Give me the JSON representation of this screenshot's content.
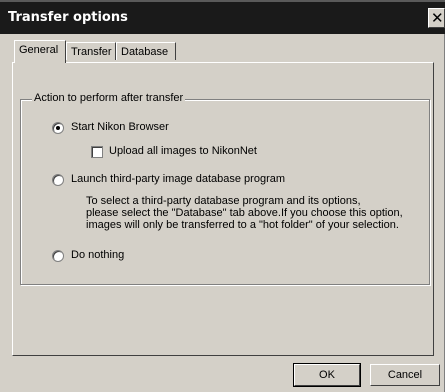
{
  "window": {
    "title": "Transfer options"
  },
  "tabs": [
    {
      "label": "General",
      "active": true
    },
    {
      "label": "Transfer",
      "active": false
    },
    {
      "label": "Database",
      "active": false
    }
  ],
  "group": {
    "title": "Action to perform after transfer",
    "options": [
      {
        "label": "Start Nikon Browser",
        "selected": true
      },
      {
        "label": "Launch third-party image database program",
        "selected": false
      },
      {
        "label": "Do nothing",
        "selected": false
      }
    ],
    "upload_checkbox": {
      "label": "Upload all images to NikonNet",
      "checked": false
    },
    "description_lines": [
      "To select a third-party database program and its options,",
      "please select the \"Database\" tab above.If you choose this option,",
      "images will only be transferred to a \"hot folder\" of your selection."
    ]
  },
  "buttons": {
    "ok": "OK",
    "cancel": "Cancel"
  },
  "icons": {
    "close": "close-icon"
  }
}
